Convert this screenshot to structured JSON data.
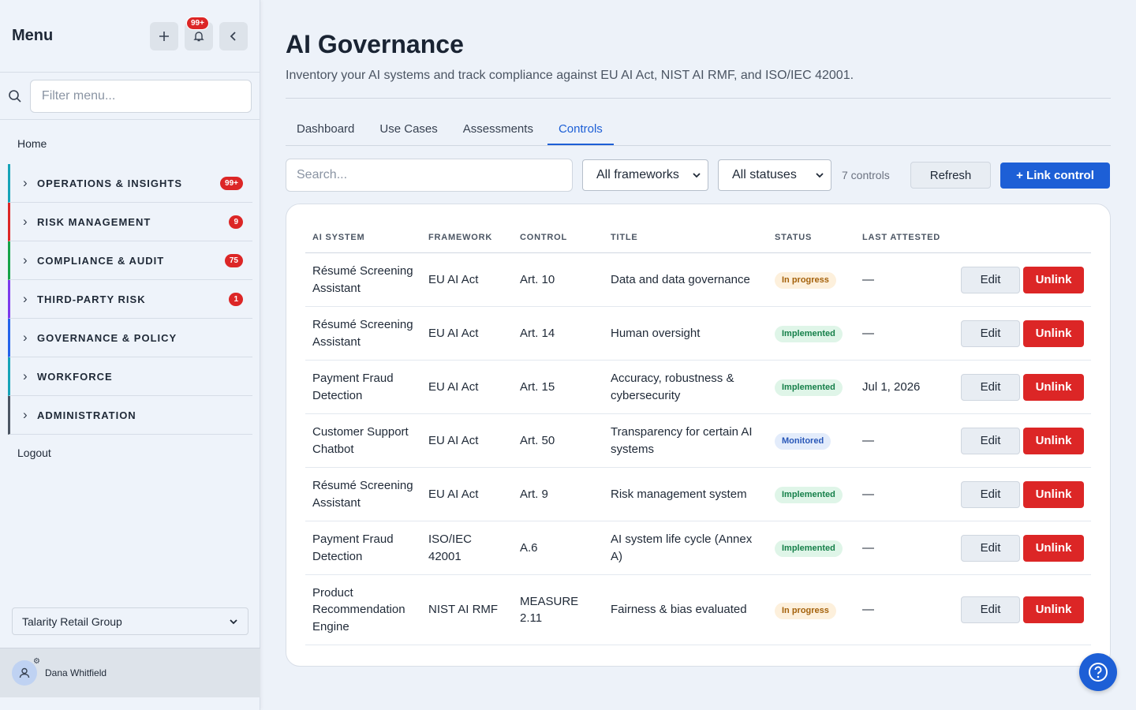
{
  "sidebar": {
    "title": "Menu",
    "notification_badge": "99+",
    "filter_placeholder": "Filter menu...",
    "home": "Home",
    "sections": [
      {
        "label": "OPERATIONS & INSIGHTS",
        "badge": "99+",
        "color": "#16a3b8"
      },
      {
        "label": "RISK MANAGEMENT",
        "badge": "9",
        "color": "#dc2626"
      },
      {
        "label": "COMPLIANCE & AUDIT",
        "badge": "75",
        "color": "#16a34a"
      },
      {
        "label": "THIRD-PARTY RISK",
        "badge": "1",
        "color": "#7c3aed"
      },
      {
        "label": "GOVERNANCE & POLICY",
        "badge": "",
        "color": "#2563eb"
      },
      {
        "label": "WORKFORCE",
        "badge": "",
        "color": "#16a3b8"
      },
      {
        "label": "ADMINISTRATION",
        "badge": "",
        "color": "#4b5563"
      }
    ],
    "logout": "Logout",
    "org": "Talarity Retail Group",
    "user": "Dana Whitfield"
  },
  "page": {
    "title": "AI Governance",
    "subtitle": "Inventory your AI systems and track compliance against EU AI Act, NIST AI RMF, and ISO/IEC 42001."
  },
  "tabs": [
    {
      "label": "Dashboard",
      "active": false
    },
    {
      "label": "Use Cases",
      "active": false
    },
    {
      "label": "Assessments",
      "active": false
    },
    {
      "label": "Controls",
      "active": true
    }
  ],
  "toolbar": {
    "search_placeholder": "Search...",
    "framework_filter": "All frameworks",
    "status_filter": "All statuses",
    "count": "7 controls",
    "refresh": "Refresh",
    "link_control": "+ Link control"
  },
  "table": {
    "headers": [
      "AI SYSTEM",
      "FRAMEWORK",
      "CONTROL",
      "TITLE",
      "STATUS",
      "LAST ATTESTED"
    ],
    "edit_label": "Edit",
    "unlink_label": "Unlink",
    "rows": [
      {
        "system": "Résumé Screening Assistant",
        "framework": "EU AI Act",
        "control": "Art. 10",
        "title": "Data and data governance",
        "status": "In progress",
        "attested": "—"
      },
      {
        "system": "Résumé Screening Assistant",
        "framework": "EU AI Act",
        "control": "Art. 14",
        "title": "Human oversight",
        "status": "Implemented",
        "attested": "—"
      },
      {
        "system": "Payment Fraud Detection",
        "framework": "EU AI Act",
        "control": "Art. 15",
        "title": "Accuracy, robustness & cybersecurity",
        "status": "Implemented",
        "attested": "Jul 1, 2026"
      },
      {
        "system": "Customer Support Chatbot",
        "framework": "EU AI Act",
        "control": "Art. 50",
        "title": "Transparency for certain AI systems",
        "status": "Monitored",
        "attested": "—"
      },
      {
        "system": "Résumé Screening Assistant",
        "framework": "EU AI Act",
        "control": "Art. 9",
        "title": "Risk management system",
        "status": "Implemented",
        "attested": "—"
      },
      {
        "system": "Payment Fraud Detection",
        "framework": "ISO/IEC 42001",
        "control": "A.6",
        "title": "AI system life cycle (Annex A)",
        "status": "Implemented",
        "attested": "—"
      },
      {
        "system": "Product Recommendation Engine",
        "framework": "NIST AI RMF",
        "control": "MEASURE 2.11",
        "title": "Fairness & bias evaluated",
        "status": "In progress",
        "attested": "—"
      }
    ]
  },
  "colors": {
    "accent": "#1d5fd6",
    "danger": "#dc2626"
  }
}
